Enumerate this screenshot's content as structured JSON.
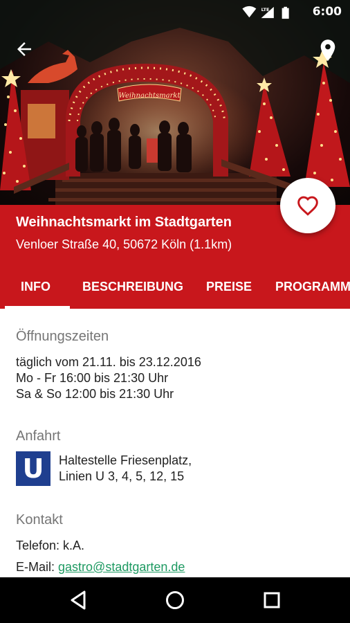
{
  "status_bar": {
    "time": "6:00",
    "network_label": "LTE",
    "icons": [
      "wifi-icon",
      "lte-signal-icon",
      "battery-icon"
    ]
  },
  "hero": {
    "description_icon": "christmas-market-photo",
    "sign_text": "Weihnachtsmarkt"
  },
  "header": {
    "title": "Weihnachtsmarkt im Stadtgarten",
    "address": "Venloer Straße 40, 50672 Köln (1.1km)",
    "tabs": [
      {
        "label": "INFO",
        "active": true
      },
      {
        "label": "BESCHREIBUNG",
        "active": false
      },
      {
        "label": "PREISE",
        "active": false
      },
      {
        "label": "PROGRAMM",
        "active": false
      }
    ]
  },
  "content": {
    "hours": {
      "title": "Öffnungszeiten",
      "lines": [
        "täglich vom 21.11. bis 23.12.2016",
        "Mo - Fr 16:00 bis 21:30 Uhr",
        "Sa & So 12:00 bis 21:30 Uhr"
      ]
    },
    "directions": {
      "title": "Anfahrt",
      "icon_letter": "U",
      "lines": [
        "Haltestelle Friesenplatz,",
        "Linien U 3, 4, 5, 12, 15"
      ]
    },
    "contact": {
      "title": "Kontakt",
      "phone": "Telefon: k.A.",
      "email_label": "E-Mail:",
      "email": "gastro@stadtgarten.de"
    }
  },
  "colors": {
    "primary_red": "#c8171c",
    "link_green": "#1e9a62",
    "ubahn_blue": "#1f3f8f"
  }
}
